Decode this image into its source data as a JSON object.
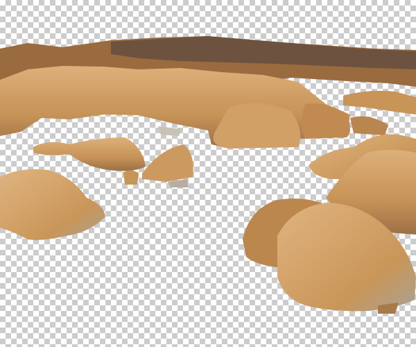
{
  "image": {
    "transparency_pattern": "checkerboard",
    "colors": {
      "checker_light": "#ffffff",
      "checker_dark": "#cccccc",
      "rock_light": "#d9a76a",
      "rock_mid": "#c38d52",
      "rock_shadow": "#8a6038",
      "rock_dark": "#5e4430",
      "rock_weathered": "#b9b2a6"
    }
  }
}
